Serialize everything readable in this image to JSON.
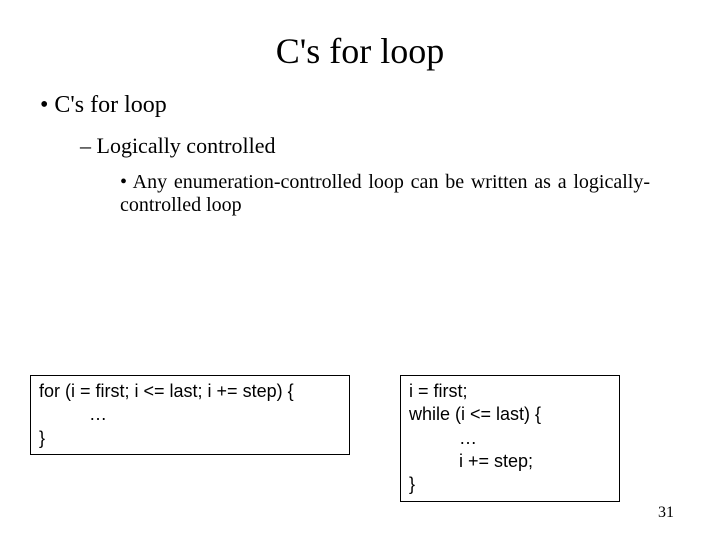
{
  "title": "C's for loop",
  "bullet1": "C's for loop",
  "bullet2": "Logically controlled",
  "bullet3": "Any enumeration-controlled loop can be written as a logically-controlled loop",
  "code_left": "for (i = first; i <= last; i += step) {\n          …\n}",
  "code_right": "i = first;\nwhile (i <= last) {\n          …\n          i += step;\n}",
  "page_number": "31"
}
